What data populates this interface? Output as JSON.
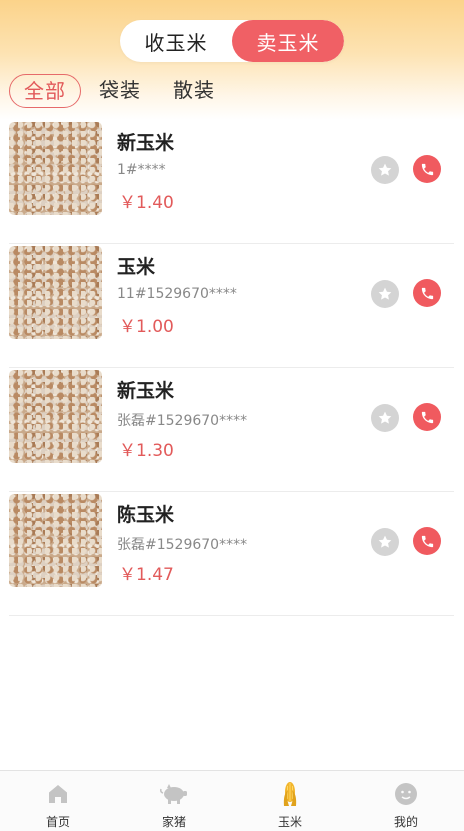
{
  "header": {
    "segments": [
      "收玉米",
      "卖玉米"
    ],
    "active_segment": 1
  },
  "filters": [
    "全部",
    "袋装",
    "散装"
  ],
  "active_filter": 0,
  "products": [
    {
      "name": "新玉米",
      "seller": "1#****",
      "price": "￥1.40"
    },
    {
      "name": "玉米",
      "seller": "11#1529670****",
      "price": "￥1.00"
    },
    {
      "name": "新玉米",
      "seller": "张磊#1529670****",
      "price": "￥1.30"
    },
    {
      "name": "陈玉米",
      "seller": "张磊#1529670****",
      "price": "￥1.47"
    }
  ],
  "tabbar": {
    "items": [
      {
        "label": "首页",
        "icon": "home-icon"
      },
      {
        "label": "家猪",
        "icon": "pig-icon"
      },
      {
        "label": "玉米",
        "icon": "corn-icon"
      },
      {
        "label": "我的",
        "icon": "profile-face-icon"
      }
    ],
    "active": 2
  },
  "colors": {
    "accent_red": "#f05a5f",
    "price_red": "#e25a5a",
    "header_gradient_top": "#fbd38a",
    "icon_gray": "#c4c4c4",
    "corn_yellow": "#f2b52b"
  }
}
